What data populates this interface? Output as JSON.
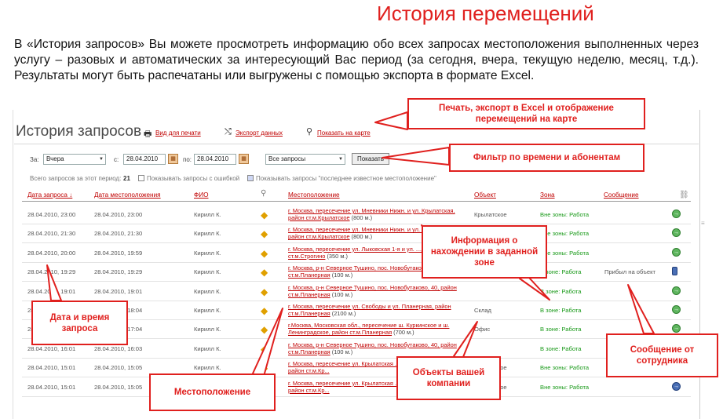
{
  "heading": "История перемещений",
  "intro": "В «История запросов» Вы можете просмотреть информацию обо всех запросах местоположения выполненных через услугу – разовых и автоматических за интересующий Вас период (за сегодня, вчера, текущую неделю, месяц, т.д.). Результаты могут быть распечатаны или выгружены с помощью экспорта в формате Excel.",
  "app": {
    "title": "История запросов",
    "links": {
      "print": "Вид для печати",
      "export": "Экспорт данных",
      "map": "Показать на карте"
    }
  },
  "filter": {
    "period_label": "За:",
    "period_value": "Вчера",
    "from_label": "с:",
    "from_value": "28.04.2010",
    "to_label": "по:",
    "to_value": "28.04.2010",
    "requests_value": "Все запросы",
    "show_button": "Показать",
    "total_label": "Всего запросов за этот период:",
    "total_value": "21",
    "error_check_label": "Показывать запросы с ошибкой",
    "last_known_label": "Показывать запросы \"последнее известное местоположение\""
  },
  "table": {
    "headers": [
      "Дата запроса ↓",
      "Дата местоположения",
      "ФИО",
      "Местоположение",
      "Объект",
      "Зона",
      "Сообщение"
    ],
    "rows": [
      {
        "req": "28.04.2010, 23:00",
        "loc_date": "28.04.2010, 23:00",
        "name": "Кирилл К.",
        "loc": "г. Москва, пересечение ул. Мневники Нижн. и ул. Крылатская, район ст.м.Крылатское",
        "dist": " (800 м.)",
        "obj": "Крылатское",
        "zone": "Вне зоны: Работа",
        "msg": "",
        "status": "green"
      },
      {
        "req": "28.04.2010, 21:30",
        "loc_date": "28.04.2010, 21:30",
        "name": "Кирилл К.",
        "loc": "г. Москва, пересечение ул. Мневники Нижн. и ул. Крылатская, район ст.м.Крылатское",
        "dist": " (800 м.)",
        "obj": "",
        "zone": "Вне зоны: Работа",
        "msg": "",
        "status": "green"
      },
      {
        "req": "28.04.2010, 20:00",
        "loc_date": "28.04.2010, 19:59",
        "name": "Кирилл К.",
        "loc": "г. Москва, пересечение ул. Лыковская 1-я и ул. ..., район ст.м.Строгино",
        "dist": " (350 м.)",
        "obj": "",
        "zone": "Вне зоны: Работа",
        "msg": "",
        "status": "green"
      },
      {
        "req": "28.04.2010, 19:29",
        "loc_date": "28.04.2010, 19:29",
        "name": "Кирилл К.",
        "loc": "г. Москва, р-н Северное Тушино, пос. Новобутаково, ст.м.Планерная",
        "dist": " (100 м.)",
        "obj": "",
        "zone": "В зоне: Работа",
        "msg": "Прибыл на объект",
        "status": "phone"
      },
      {
        "req": "28.04.2010, 19:01",
        "loc_date": "28.04.2010, 19:01",
        "name": "Кирилл К.",
        "loc": "г. Москва, р-н Северное Тушино, пос. Новобутаково, 40, район ст.м.Планерная",
        "dist": " (100 м.)",
        "obj": "",
        "zone": "В зоне: Работа",
        "msg": "",
        "status": "green"
      },
      {
        "req": "28.04.2010, 18:04",
        "loc_date": "28.04.2010, 18:04",
        "name": "Кирилл К.",
        "loc": "г. Москва, пересечение ул. Свободы и ул. Планерная, район ст.м.Планерная",
        "dist": " (2100 м.)",
        "obj": "Склад",
        "zone": "В зоне: Работа",
        "msg": "",
        "status": "green"
      },
      {
        "req": "28.04.2010, 17:04",
        "loc_date": "28.04.2010, 17:04",
        "name": "Кирилл К.",
        "loc": "г.Москва, Московская обл., пересечение ш. Куркинское и ш. Ленинградское, район ст.м.Планерная",
        "dist": " (700 м.)",
        "obj": "Офис",
        "zone": "В зоне: Работа",
        "msg": "",
        "status": "green"
      },
      {
        "req": "28.04.2010, 16:01",
        "loc_date": "28.04.2010, 16:03",
        "name": "Кирилл К.",
        "loc": "г. Москва, р-н Северное Тушино, пос. Новобутаково, 40, район ст.м.Планерная",
        "dist": " (100 м.)",
        "obj": "",
        "zone": "В зоне: Работа",
        "msg": "",
        "status": "green"
      },
      {
        "req": "28.04.2010, 15:01",
        "loc_date": "28.04.2010, 15:05",
        "name": "Кирилл К.",
        "loc": "г. Москва, пересечение ул. Крылатская ..., Проектируемый №369, район ст.м.Кр...",
        "dist": "",
        "obj": "Крылатское",
        "zone": "Вне зоны: Работа",
        "msg": "",
        "status": "green"
      },
      {
        "req": "28.04.2010, 15:01",
        "loc_date": "28.04.2010, 15:05",
        "name": "Кирилл К.",
        "loc": "г. Москва, пересечение ул. Крылатская ..., Проектируемый №369, район ст.м.Кр...",
        "dist": "",
        "obj": "Крылатское",
        "zone": "Вне зоны: Работа",
        "msg": "",
        "status": "blue"
      }
    ]
  },
  "callouts": {
    "export": "Печать, экспорт в Excel и отображение перемещений на карте",
    "filter": "Фильтр по времени  и абонентам",
    "zone": "Информация о нахождении в заданной зоне",
    "date": "Дата и время запроса",
    "location": "Местоположение",
    "objects": "Объекты вашей компании",
    "message": "Сообщение от сотрудника"
  },
  "colors": {
    "accent": "#e0201e",
    "link": "#c00000",
    "zone": "#1a9a1a"
  }
}
